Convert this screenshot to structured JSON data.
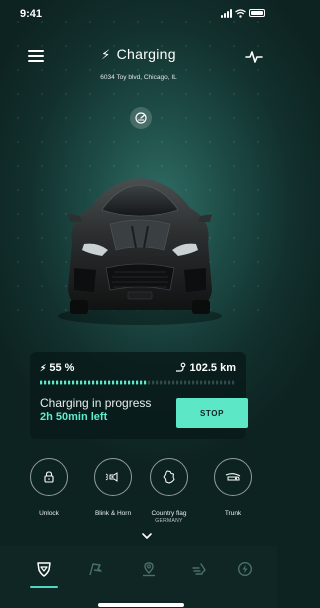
{
  "status_bar": {
    "time": "9:41"
  },
  "header": {
    "title": "Charging",
    "address": "6034 Toy blvd, Chicago, IL"
  },
  "charge_panel": {
    "percent": "55 %",
    "percent_value": 55,
    "range": "102.5 km",
    "status": "Charging in progress",
    "time_left": "2h 50min left",
    "stop_label": "STOP"
  },
  "actions": [
    {
      "label": "Unlock",
      "sub": "",
      "icon": "lock-icon"
    },
    {
      "label": "Blink & Horn",
      "sub": "",
      "icon": "horn-icon"
    },
    {
      "label": "Country flag",
      "sub": "GERMANY",
      "icon": "country-map-icon"
    },
    {
      "label": "Trunk",
      "sub": "",
      "icon": "trunk-icon"
    }
  ],
  "tabs": [
    {
      "name": "car-tab",
      "icon": "shield-car-icon",
      "active": true
    },
    {
      "name": "flag-tab",
      "icon": "flag-icon",
      "active": false
    },
    {
      "name": "location-tab",
      "icon": "location-pin-icon",
      "active": false
    },
    {
      "name": "speed-tab",
      "icon": "speed-lines-icon",
      "active": false
    },
    {
      "name": "charge-tab",
      "icon": "charge-bolt-icon",
      "active": false
    }
  ],
  "colors": {
    "accent": "#5ce8c7",
    "background": "#1d4a45",
    "panel": "#081a1a"
  }
}
